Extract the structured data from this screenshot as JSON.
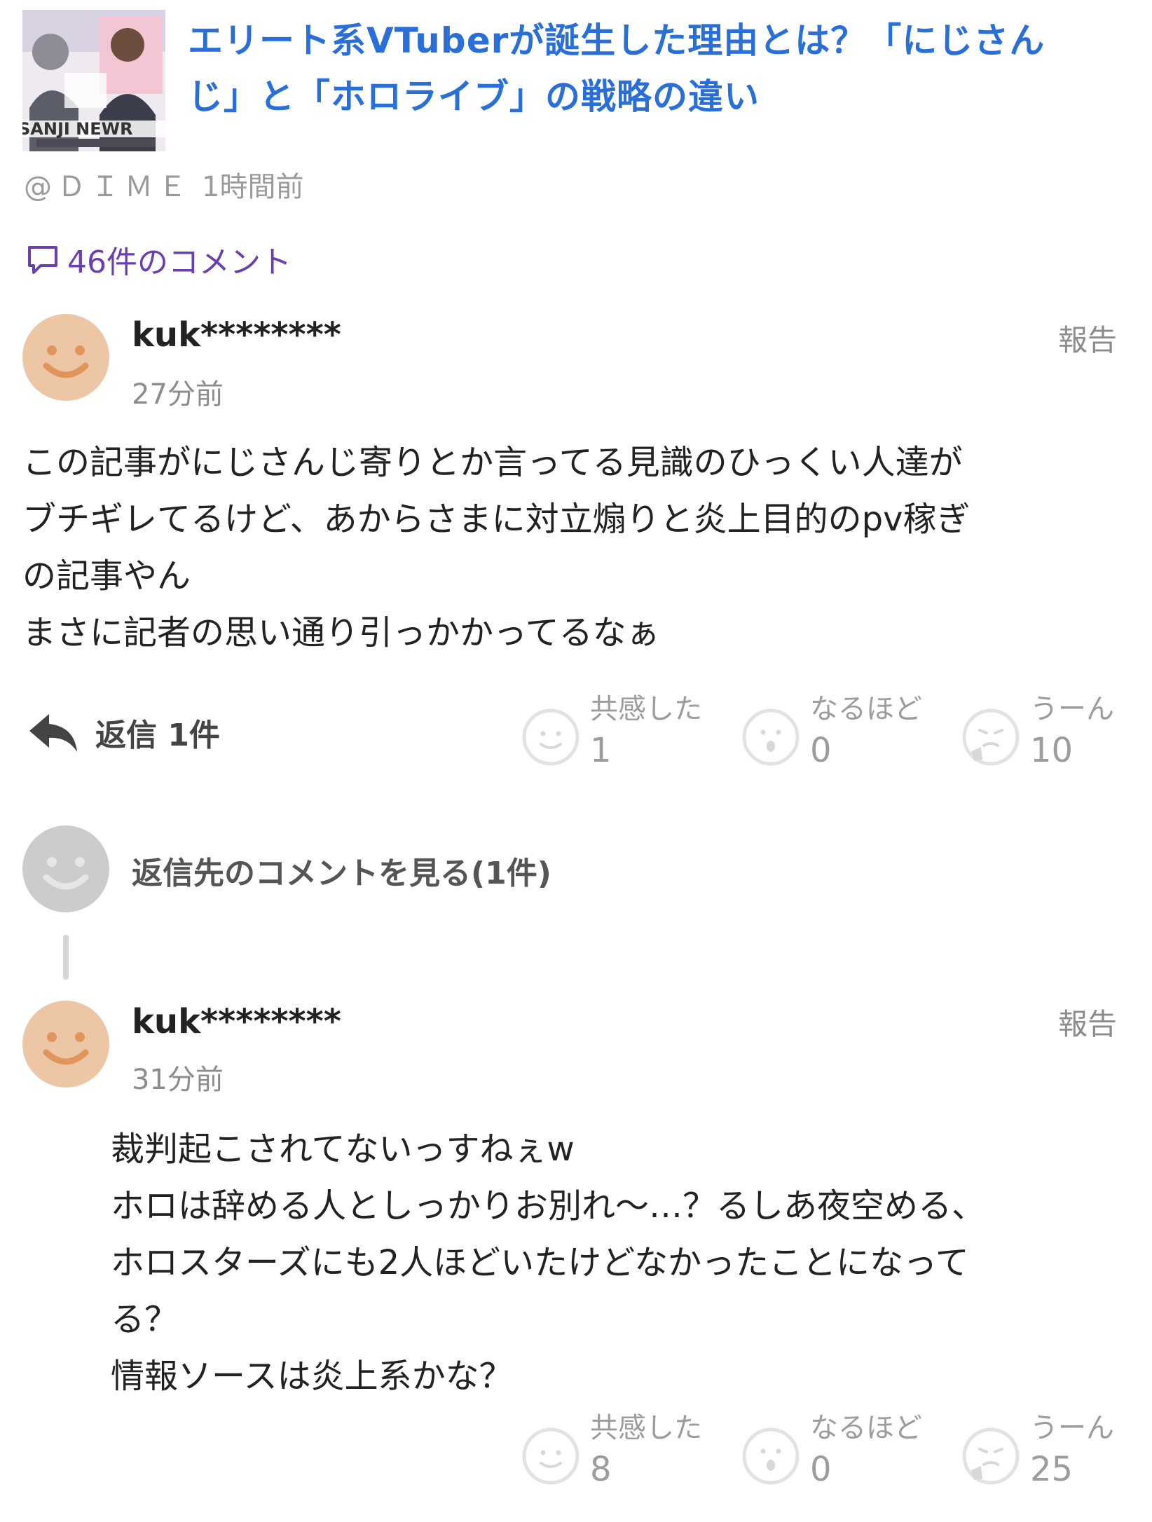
{
  "article": {
    "thumbnail_caption": "SANJI NEWR",
    "title_line1": "エリート系VTuberが誕生した理由とは？「にじさん",
    "title_line2": "じ」と「ホロライブ」の戦略の違い",
    "source": "@ＤＩＭＥ",
    "time": "1時間前",
    "comment_count_label": "46件のコメント"
  },
  "comments": [
    {
      "username": "kuk********",
      "time": "27分前",
      "report_label": "報告",
      "body_lines": [
        "この記事がにじさんじ寄りとか言ってる見識のひっくい人達が",
        "ブチギレてるけど、あからさまに対立煽りと炎上目的のpv稼ぎ",
        "の記事やん",
        "まさに記者の思い通り引っかかってるなぁ"
      ],
      "reply_label": "返信 1件",
      "reactions": [
        {
          "label": "共感した",
          "count": "1",
          "icon": "smile-icon"
        },
        {
          "label": "なるほど",
          "count": "0",
          "icon": "surprised-icon"
        },
        {
          "label": "うーん",
          "count": "10",
          "icon": "thinking-icon"
        }
      ]
    },
    {
      "username": "kuk********",
      "time": "31分前",
      "report_label": "報告",
      "body_lines": [
        "裁判起こされてないっすねぇw",
        "ホロは辞める人としっかりお別れ〜…？るしあ夜空める、",
        "ホロスターズにも2人ほどいたけどなかったことになって",
        "る？",
        "情報ソースは炎上系かな？"
      ],
      "reactions": [
        {
          "label": "共感した",
          "count": "8",
          "icon": "smile-icon"
        },
        {
          "label": "なるほど",
          "count": "0",
          "icon": "surprised-icon"
        },
        {
          "label": "うーん",
          "count": "25",
          "icon": "thinking-icon"
        }
      ]
    }
  ],
  "see_reply_label": "返信先のコメントを見る(1件)",
  "colors": {
    "title": "#2a6fd8",
    "comment_count": "#6a3fb0",
    "avatar_user": "#edc7a5",
    "avatar_placeholder": "#cccccc"
  }
}
